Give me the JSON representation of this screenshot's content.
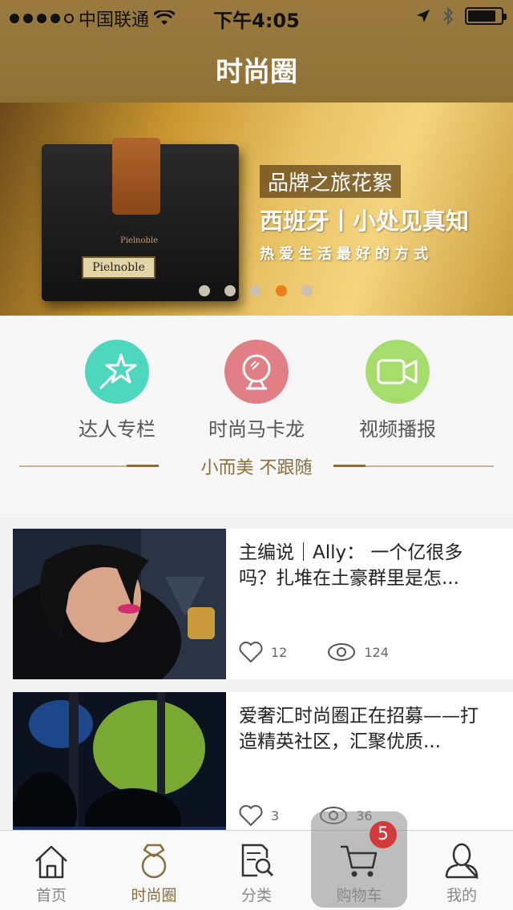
{
  "status_bar": {
    "carrier": "中国联通",
    "time": "下午4:05"
  },
  "nav": {
    "title": "时尚圈"
  },
  "banner": {
    "wallet_brand": "Pielnoble",
    "tag": "品牌之旅花絮",
    "headline": "西班牙丨小处见真知",
    "subline": "热爱生活最好的方式",
    "active_page": 3,
    "page_count": 5
  },
  "categories": [
    {
      "label": "达人专栏",
      "icon": "star-wand-icon",
      "color": "#4fd6bf"
    },
    {
      "label": "时尚马卡龙",
      "icon": "mirror-icon",
      "color": "#e07f86"
    },
    {
      "label": "视频播报",
      "icon": "video-camera-icon",
      "color": "#a6dc6c"
    }
  ],
  "section_divider": "小而美 不跟随",
  "articles": [
    {
      "title": "主编说｜Ally： 一个亿很多吗？扎堆在土豪群里是怎...",
      "likes": "12",
      "views": "124"
    },
    {
      "title": "爱奢汇时尚圈正在招募——打造精英社区，汇聚优质...",
      "likes": "3",
      "views": "36"
    }
  ],
  "tabs": [
    {
      "label": "首页",
      "icon": "home-icon"
    },
    {
      "label": "时尚圈",
      "icon": "ring-icon",
      "active": true
    },
    {
      "label": "分类",
      "icon": "search-doc-icon"
    },
    {
      "label": "购物车",
      "icon": "cart-icon",
      "badge": "5"
    },
    {
      "label": "我的",
      "icon": "user-icon"
    }
  ],
  "colors": {
    "nav_bg": "#957638",
    "accent": "#8a6d3b",
    "pager_active": "#f07c14",
    "badge": "#d33a3a"
  }
}
